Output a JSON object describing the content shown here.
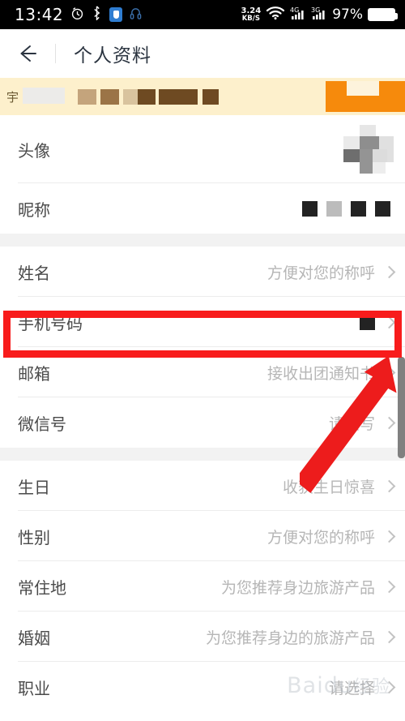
{
  "statusbar": {
    "time": "13:42",
    "icons": [
      "alarm-icon",
      "bluetooth-icon",
      "shield-icon",
      "headset-icon"
    ],
    "net_speed_value": "3.24",
    "net_speed_unit": "KB/S",
    "wifi": "wifi-icon",
    "sim1_label": "4G",
    "sim2_label": "3G",
    "battery_percent": "97%"
  },
  "header": {
    "back": "back-arrow-icon",
    "title": "个人资料"
  },
  "promo": {
    "leading_char": "宇",
    "button_label": ""
  },
  "profile": {
    "avatar_label": "头像",
    "nickname_label": "昵称"
  },
  "list": {
    "rows": [
      {
        "label": "姓名",
        "hint": "方便对您的称呼"
      },
      {
        "label": "手机号码",
        "hint": ""
      },
      {
        "label": "邮箱",
        "hint": "接收出团通知书"
      },
      {
        "label": "微信号",
        "hint": "请填写"
      },
      {
        "label": "生日",
        "hint": "收获生日惊喜"
      },
      {
        "label": "性别",
        "hint": "方便对您的称呼"
      },
      {
        "label": "常住地",
        "hint": "为您推荐身边旅游产品"
      },
      {
        "label": "婚姻",
        "hint": "为您推荐身边的旅游产品"
      },
      {
        "label": "职业",
        "hint": "请选择"
      }
    ]
  },
  "annotation": {
    "highlight_color": "#f81c1c",
    "arrow_color": "#ed1c1c",
    "highlight_target": "手机号码"
  },
  "watermark": {
    "text_main": "Baidu",
    "text_sub": "经验"
  }
}
